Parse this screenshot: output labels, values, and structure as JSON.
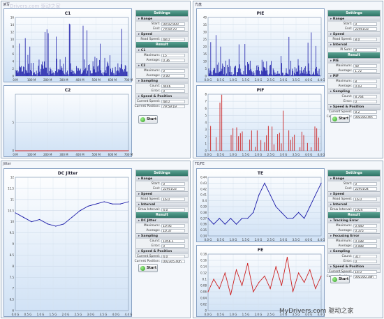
{
  "quadrants": [
    {
      "tab": "读写",
      "chart_top": {
        "title": "C1"
      },
      "chart_bottom": {
        "title": "C2"
      },
      "panel": {
        "title": "Settings",
        "sections": [
          {
            "name": "Range",
            "rows": [
              {
                "label": "Start:",
                "value": "00:02:000"
              },
              {
                "label": "End:",
                "value": "79:59:70"
              }
            ]
          },
          {
            "name": "Speed",
            "rows": [
              {
                "label": "Read Speed:",
                "value": "48.0"
              }
            ]
          }
        ],
        "result_title": "Result",
        "result_sections": [
          {
            "name": "C1",
            "rows": [
              {
                "label": "Maximum:",
                "value": "15"
              },
              {
                "label": "Average:",
                "value": "0.36"
              }
            ]
          },
          {
            "name": "C2",
            "rows": [
              {
                "label": "Maximum:",
                "value": "0"
              },
              {
                "label": "Average:",
                "value": "0.00"
              }
            ]
          },
          {
            "name": "Sampling",
            "rows": [
              {
                "label": "Count:",
                "value": "4446"
              },
              {
                "label": "Error:",
                "value": "0"
              }
            ]
          },
          {
            "name": "Speed & Position",
            "rows": [
              {
                "label": "Current Speed:",
                "value": "48.0"
              },
              {
                "label": "Current Position:",
                "value": "79:59:19"
              }
            ]
          }
        ],
        "start_label": "Start"
      }
    },
    {
      "tab": "光盘",
      "chart_top": {
        "title": "PIE"
      },
      "chart_bottom": {
        "title": "PIF"
      },
      "panel": {
        "title": "Settings",
        "sections": [
          {
            "name": "Range",
            "rows": [
              {
                "label": "Start:",
                "value": "0"
              },
              {
                "label": "End:",
                "value": "2295103"
              }
            ]
          },
          {
            "name": "Speed",
            "rows": [
              {
                "label": "Read Speed:",
                "value": "8.0"
              }
            ]
          },
          {
            "name": "Interval",
            "rows": [
              {
                "label": "PI Sum:",
                "value": "8"
              }
            ]
          }
        ],
        "result_title": "Result",
        "result_sections": [
          {
            "name": "PIE",
            "rows": [
              {
                "label": "Maximum:",
                "value": "40"
              },
              {
                "label": "Average:",
                "value": "1.72"
              }
            ]
          },
          {
            "name": "PIF",
            "rows": [
              {
                "label": "Maximum:",
                "value": "8"
              },
              {
                "label": "Average:",
                "value": "0.03"
              }
            ]
          },
          {
            "name": "Sampling",
            "rows": [
              {
                "label": "Count:",
                "value": "8,764"
              },
              {
                "label": "Error:",
                "value": "0"
              }
            ]
          },
          {
            "name": "Speed & Position",
            "rows": [
              {
                "label": "Current Speed:",
                "value": "8.2"
              },
              {
                "label": "Current Position:",
                "value": "002300.4th"
              }
            ]
          }
        ],
        "start_label": "Start"
      }
    },
    {
      "tab": "Jitter",
      "chart_top": {
        "title": "DC Jitter"
      },
      "panel": {
        "title": "Settings",
        "sections": [
          {
            "name": "Range",
            "rows": [
              {
                "label": "Start:",
                "value": "0"
              },
              {
                "label": "End:",
                "value": "2295103"
              }
            ]
          },
          {
            "name": "Speed",
            "rows": [
              {
                "label": "Read Speed:",
                "value": "16.0"
              }
            ]
          },
          {
            "name": "Interval",
            "rows": [
              {
                "label": "Draw Interval:",
                "value": "4.0"
              }
            ]
          }
        ],
        "result_title": "Result",
        "result_sections": [
          {
            "name": "DC Jitter",
            "rows": [
              {
                "label": "Maximum:",
                "value": "10.95"
              },
              {
                "label": "Average:",
                "value": "10.37"
              }
            ]
          },
          {
            "name": "Sampling",
            "rows": [
              {
                "label": "Count:",
                "value": "1956.1"
              },
              {
                "label": "Error:",
                "value": "0"
              }
            ]
          },
          {
            "name": "Speed & Position",
            "rows": [
              {
                "label": "Current Speed:",
                "value": "4.0"
              },
              {
                "label": "Current Position:",
                "value": "002305.40h"
              }
            ]
          }
        ],
        "start_label": "Start"
      }
    },
    {
      "tab": "TE/FE",
      "chart_top": {
        "title": "TE"
      },
      "chart_bottom": {
        "title": "FE"
      },
      "panel": {
        "title": "Settings",
        "sections": [
          {
            "name": "Range",
            "rows": [
              {
                "label": "Start:",
                "value": "0"
              },
              {
                "label": "End:",
                "value": "2293104"
              }
            ]
          },
          {
            "name": "Speed",
            "rows": [
              {
                "label": "Read Speed:",
                "value": "16.0"
              }
            ]
          },
          {
            "name": "Interval",
            "rows": [
              {
                "label": "Draw Interval:",
                "value": "1024"
              }
            ]
          }
        ],
        "result_title": "Result",
        "result_sections": [
          {
            "name": "Tracking Error",
            "rows": [
              {
                "label": "Maximum:",
                "value": "0.440"
              },
              {
                "label": "Average:",
                "value": "0.375"
              }
            ]
          },
          {
            "name": "Focusing Error",
            "rows": [
              {
                "label": "Maximum:",
                "value": "0.188"
              },
              {
                "label": "Average:",
                "value": "0.088"
              }
            ]
          },
          {
            "name": "Sampling",
            "rows": [
              {
                "label": "Count:",
                "value": "317"
              },
              {
                "label": "Error:",
                "value": "0"
              }
            ]
          },
          {
            "name": "Speed & Position",
            "rows": [
              {
                "label": "Current Speed:",
                "value": "16.0"
              },
              {
                "label": "Current Position:",
                "value": "002300.38h"
              }
            ]
          }
        ],
        "start_label": "Start"
      }
    }
  ],
  "chart_data": [
    {
      "type": "bar",
      "title": "C1",
      "color": "#1a1aa8",
      "x": [
        "0 M",
        "100 M",
        "200 M",
        "300 M",
        "400 M",
        "500 M",
        "600 M",
        "700 M"
      ],
      "yticks": [
        0,
        2,
        4,
        6,
        8,
        10,
        12,
        14,
        16
      ],
      "ylim": [
        0,
        16
      ]
    },
    {
      "type": "line",
      "title": "C2",
      "color": "#cc2020",
      "x": [
        "0 M",
        "100 M",
        "200 M",
        "300 M",
        "400 M",
        "500 M",
        "600 M",
        "700 M"
      ],
      "yticks": [
        0,
        5
      ],
      "ylim": [
        0,
        10
      ],
      "values": [
        0,
        0,
        0,
        0,
        0,
        0,
        0,
        0
      ]
    },
    {
      "type": "bar",
      "title": "PIE",
      "color": "#1a1aa8",
      "x": [
        "0.0 G",
        "0.5 G",
        "1.0 G",
        "1.5 G",
        "2.0 G",
        "2.5 G",
        "3.0 G",
        "3.5 G",
        "4.0 G",
        "4.4 G"
      ],
      "yticks": [
        0,
        5,
        10,
        15,
        20,
        25,
        30,
        35,
        40
      ],
      "ylim": [
        0,
        40
      ]
    },
    {
      "type": "bar",
      "title": "PIF",
      "color": "#cc2020",
      "x": [
        "0.0 G",
        "0.5 G",
        "1.0 G",
        "1.5 G",
        "2.0 G",
        "2.5 G",
        "3.0 G",
        "3.5 G",
        "4.0 G",
        "4.4 G"
      ],
      "yticks": [
        0,
        1,
        2,
        3,
        4,
        5,
        6,
        7,
        8
      ],
      "ylim": [
        0,
        8
      ]
    },
    {
      "type": "line",
      "title": "DC Jitter",
      "color": "#1a1aa8",
      "x": [
        "0.0 G",
        "0.5 G",
        "1.0 G",
        "1.5 G",
        "2.0 G",
        "2.5 G",
        "3.0 G",
        "3.5 G",
        "4.0 G",
        "4.4 G"
      ],
      "yticks": [
        6,
        6.5,
        7,
        7.5,
        8,
        8.5,
        9,
        9.5,
        10,
        10.5,
        11,
        11.5,
        12
      ],
      "ylim": [
        6,
        12
      ],
      "values": [
        10.4,
        10.2,
        10.0,
        10.1,
        9.9,
        9.8,
        9.9,
        10.2,
        10.5,
        10.7,
        10.8,
        10.9,
        10.8,
        10.8,
        10.9
      ]
    },
    {
      "type": "line",
      "title": "TE",
      "color": "#1a1aa8",
      "x": [
        "0.0 G",
        "0.5 G",
        "1.0 G",
        "1.5 G",
        "2.0 G",
        "2.5 G",
        "3.0 G",
        "3.5 G",
        "4.0 G",
        "4.4 G"
      ],
      "yticks": [
        0.34,
        0.35,
        0.36,
        0.37,
        0.38,
        0.39,
        0.4,
        0.41,
        0.42,
        0.43,
        0.44
      ],
      "ylim": [
        0.34,
        0.44
      ],
      "values": [
        0.37,
        0.36,
        0.37,
        0.36,
        0.37,
        0.36,
        0.37,
        0.37,
        0.38,
        0.41,
        0.43,
        0.41,
        0.39,
        0.38,
        0.37,
        0.37,
        0.38,
        0.37,
        0.39,
        0.41,
        0.43
      ]
    },
    {
      "type": "line",
      "title": "FE",
      "color": "#cc2020",
      "x": [
        "0.0 G",
        "0.5 G",
        "1.0 G",
        "1.5 G",
        "2.0 G",
        "2.5 G",
        "3.0 G",
        "3.5 G",
        "4.0 G",
        "4.4 G"
      ],
      "yticks": [
        0,
        0.02,
        0.04,
        0.06,
        0.08,
        0.1,
        0.12,
        0.14,
        0.16,
        0.18
      ],
      "ylim": [
        0,
        0.18
      ],
      "values": [
        0.06,
        0.1,
        0.07,
        0.12,
        0.05,
        0.13,
        0.08,
        0.15,
        0.06,
        0.09,
        0.11,
        0.07,
        0.14,
        0.08,
        0.17,
        0.06,
        0.12,
        0.09,
        0.13,
        0.07,
        0.11
      ]
    }
  ],
  "watermarks": {
    "top": "Drivers.com 驱动之家",
    "bottom": "MyDrivers.com 驱动之家"
  }
}
